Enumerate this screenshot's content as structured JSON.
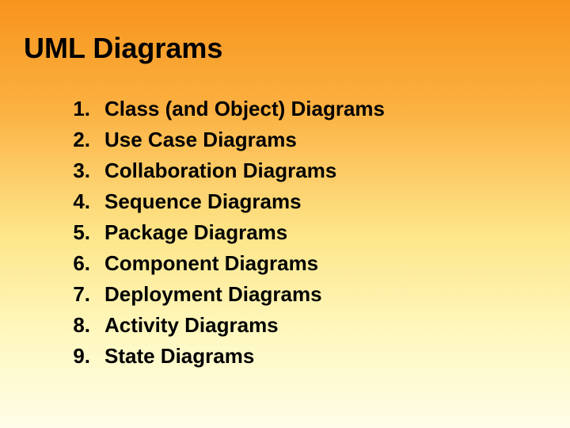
{
  "title": "UML Diagrams",
  "items": [
    {
      "num": "1.",
      "text": "Class (and Object) Diagrams"
    },
    {
      "num": "2.",
      "text": "Use Case Diagrams"
    },
    {
      "num": "3.",
      "text": "Collaboration Diagrams"
    },
    {
      "num": "4.",
      "text": "Sequence Diagrams"
    },
    {
      "num": "5.",
      "text": "Package Diagrams"
    },
    {
      "num": "6.",
      "text": "Component Diagrams"
    },
    {
      "num": "7.",
      "text": "Deployment Diagrams"
    },
    {
      "num": "8.",
      "text": "Activity Diagrams"
    },
    {
      "num": "9.",
      "text": "State Diagrams"
    }
  ]
}
